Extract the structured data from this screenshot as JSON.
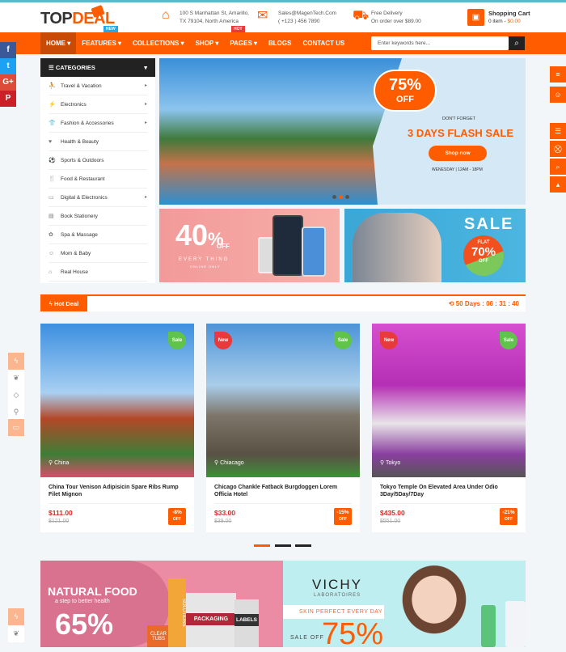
{
  "header": {
    "logo_part1": "TOP",
    "logo_part2": "DEAL",
    "address_line1": "100 S Manhattan St, Amarillo,",
    "address_line2": "TX 79104, North America",
    "email": "Sales@MagenTech.Com",
    "phone": "( +123 ) 456 7890",
    "delivery_title": "Free Delivery",
    "delivery_sub": "On order over $89.00",
    "cart_title": "Shopping Cart",
    "cart_items": "0 item - ",
    "cart_total": "$0.00"
  },
  "nav": {
    "items": [
      {
        "label": "HOME ▾"
      },
      {
        "label": "FEATURES ▾",
        "badge": "NEW"
      },
      {
        "label": "COLLECTIONS ▾"
      },
      {
        "label": "SHOP ▾"
      },
      {
        "label": "PAGES ▾",
        "badge": "HOT"
      },
      {
        "label": "BLOGS"
      },
      {
        "label": "CONTACT US"
      }
    ],
    "search_placeholder": "Enter keywords here..."
  },
  "colors": {
    "accent": "#ff5c00",
    "dark": "#222222",
    "price": "#e02424",
    "sale": "#5fc449",
    "new": "#e83a3a"
  },
  "social": [
    "f",
    "t",
    "G+",
    "P"
  ],
  "categories": {
    "title": "CATEGORIES",
    "items": [
      {
        "label": "Travel & Vacation",
        "arrow": true
      },
      {
        "label": "Electronics",
        "arrow": true
      },
      {
        "label": "Fashion & Accessories",
        "arrow": true
      },
      {
        "label": "Health & Beauty",
        "arrow": false
      },
      {
        "label": "Sports & Outdoors",
        "arrow": false
      },
      {
        "label": "Food & Restaurant",
        "arrow": false
      },
      {
        "label": "Digital & Electronics",
        "arrow": true
      },
      {
        "label": "Book Stationery",
        "arrow": false
      },
      {
        "label": "Spa & Massage",
        "arrow": false
      },
      {
        "label": "Mom & Baby",
        "arrow": false
      },
      {
        "label": "Real House",
        "arrow": false
      }
    ]
  },
  "slider": {
    "badge_pct": "75%",
    "badge_off": "OFF",
    "kicker": "DON'T FORGET",
    "title": "3 DAYS FLASH SALE",
    "button": "Shop now",
    "schedule": "WENESDAY | 12AM - 18PM"
  },
  "banner1": {
    "pct": "40",
    "pct_sign": "%",
    "off": "OFF",
    "line1": "EVERY THING",
    "line2": "ONLINE ONLY"
  },
  "banner2": {
    "sale": "SALE",
    "flat": "FLAT",
    "pct": "70%",
    "off": "OFF"
  },
  "hotdeal": {
    "label": "Hot Deal",
    "timer": "50 Days : 06 : 31 : 40"
  },
  "products": [
    {
      "location": "China",
      "title": "China Tour Venison Adipisicin Spare Ribs Rump Filet Mignon",
      "price": "$111.00",
      "old": "$121.00",
      "discount": "-8%",
      "off": "OFF",
      "labels": [
        "Sale"
      ]
    },
    {
      "location": "Chiacago",
      "title": "Chicago Chankle Fatback Burgdoggen Lorem Officia Hotel",
      "price": "$33.00",
      "old": "$39.00",
      "discount": "-15%",
      "off": "OFF",
      "labels": [
        "New",
        "Sale"
      ]
    },
    {
      "location": "Tokyo",
      "title": "Tokyo Temple On Elevated Area Under Odio 3Day/5Day/7Day",
      "price": "$435.00",
      "old": "$551.00",
      "discount": "-21%",
      "off": "OFF",
      "labels": [
        "New",
        "Sale"
      ]
    }
  ],
  "bottom1": {
    "title": "NATURAL FOOD",
    "sub": "a step to better health",
    "pct": "65%",
    "pack1": "CLEAR TUBS",
    "pack2": "SOLUTIONS",
    "pack3": "PACKAGING",
    "pack4": "LABELS"
  },
  "bottom2": {
    "brand": "VICHY",
    "brand_sub": "LABORATOIRES",
    "tagline": "SKIN PERFECT EVERY DAY",
    "sale": "SALE OFF",
    "pct": "75%"
  }
}
